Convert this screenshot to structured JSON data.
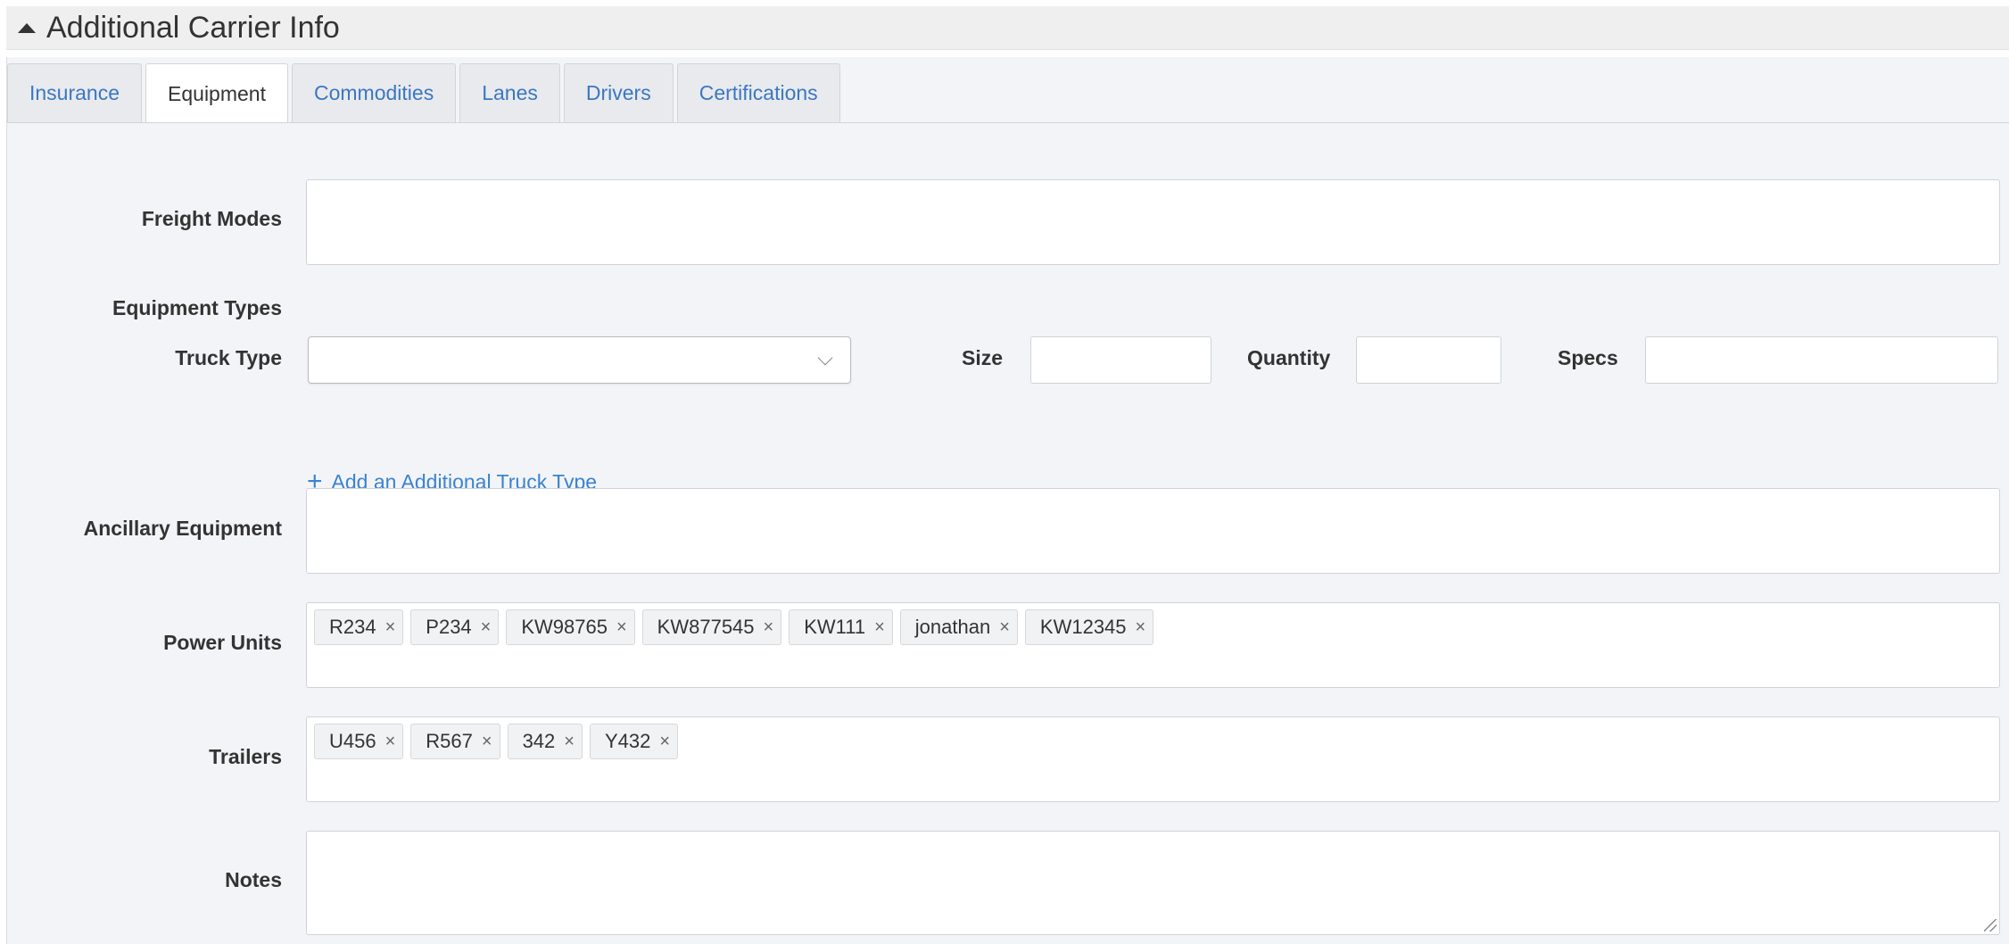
{
  "section": {
    "title": "Additional Carrier Info"
  },
  "tabs": [
    {
      "label": "Insurance"
    },
    {
      "label": "Equipment"
    },
    {
      "label": "Commodities"
    },
    {
      "label": "Lanes"
    },
    {
      "label": "Drivers"
    },
    {
      "label": "Certifications"
    }
  ],
  "form": {
    "freight_modes_label": "Freight Modes",
    "equipment_types_label": "Equipment Types",
    "truck_type_label": "Truck Type",
    "size_label": "Size",
    "quantity_label": "Quantity",
    "specs_label": "Specs",
    "add_truck_type_label": "Add an Additional Truck Type",
    "ancillary_label": "Ancillary Equipment",
    "power_units_label": "Power Units",
    "trailers_label": "Trailers",
    "notes_label": "Notes"
  },
  "power_units": [
    "R234",
    "P234",
    "KW98765",
    "KW877545",
    "KW111",
    "jonathan",
    "KW12345"
  ],
  "trailers": [
    "U456",
    "R567",
    "342",
    "Y432"
  ],
  "icons": {
    "remove": "×",
    "plus": "+"
  },
  "colors": {
    "link": "#3a83d2",
    "panel_bg": "#f3f4f7"
  }
}
